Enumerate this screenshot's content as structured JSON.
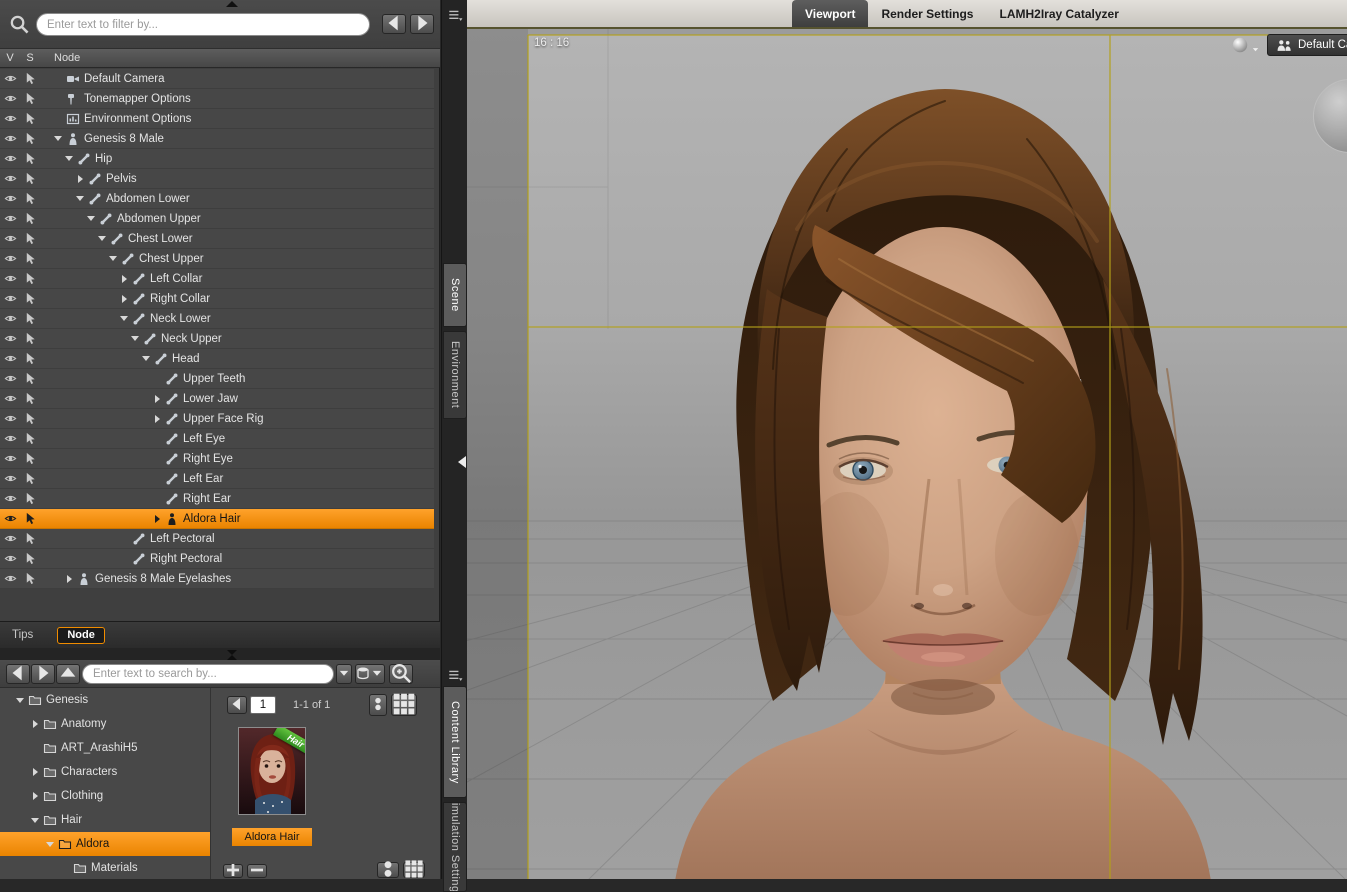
{
  "colors": {
    "accent": "#f08c00",
    "guide_yellow": "#b3a01a",
    "badge_green": "#3fae3f"
  },
  "scene_panel": {
    "filter_placeholder": "Enter text to filter by...",
    "columns": {
      "v": "V",
      "s": "S",
      "node": "Node"
    },
    "nodes": [
      {
        "label": "Default Camera",
        "indent": 0,
        "icon": "camera",
        "expander": "none"
      },
      {
        "label": "Tonemapper Options",
        "indent": 0,
        "icon": "tonemapper",
        "expander": "none"
      },
      {
        "label": "Environment Options",
        "indent": 0,
        "icon": "environment",
        "expander": "none"
      },
      {
        "label": "Genesis 8 Male",
        "indent": 0,
        "icon": "figure",
        "expander": "open"
      },
      {
        "label": "Hip",
        "indent": 1,
        "icon": "bone",
        "expander": "open"
      },
      {
        "label": "Pelvis",
        "indent": 2,
        "icon": "bone",
        "expander": "closed"
      },
      {
        "label": "Abdomen Lower",
        "indent": 2,
        "icon": "bone",
        "expander": "open"
      },
      {
        "label": "Abdomen Upper",
        "indent": 3,
        "icon": "bone",
        "expander": "open"
      },
      {
        "label": "Chest Lower",
        "indent": 4,
        "icon": "bone",
        "expander": "open"
      },
      {
        "label": "Chest Upper",
        "indent": 5,
        "icon": "bone",
        "expander": "open"
      },
      {
        "label": "Left Collar",
        "indent": 6,
        "icon": "bone",
        "expander": "closed"
      },
      {
        "label": "Right Collar",
        "indent": 6,
        "icon": "bone",
        "expander": "closed"
      },
      {
        "label": "Neck Lower",
        "indent": 6,
        "icon": "bone",
        "expander": "open"
      },
      {
        "label": "Neck Upper",
        "indent": 7,
        "icon": "bone",
        "expander": "open"
      },
      {
        "label": "Head",
        "indent": 8,
        "icon": "bone",
        "expander": "open"
      },
      {
        "label": "Upper Teeth",
        "indent": 9,
        "icon": "bone",
        "expander": "none"
      },
      {
        "label": "Lower Jaw",
        "indent": 9,
        "icon": "bone",
        "expander": "closed"
      },
      {
        "label": "Upper Face Rig",
        "indent": 9,
        "icon": "bone",
        "expander": "closed"
      },
      {
        "label": "Left Eye",
        "indent": 9,
        "icon": "bone",
        "expander": "none"
      },
      {
        "label": "Right Eye",
        "indent": 9,
        "icon": "bone",
        "expander": "none"
      },
      {
        "label": "Left Ear",
        "indent": 9,
        "icon": "bone",
        "expander": "none"
      },
      {
        "label": "Right Ear",
        "indent": 9,
        "icon": "bone",
        "expander": "none"
      },
      {
        "label": "Aldora Hair",
        "indent": 9,
        "icon": "figure",
        "expander": "closed",
        "selected": true
      },
      {
        "label": "Left Pectoral",
        "indent": 6,
        "icon": "bone",
        "expander": "none"
      },
      {
        "label": "Right Pectoral",
        "indent": 6,
        "icon": "bone",
        "expander": "none"
      },
      {
        "label": "Genesis 8 Male Eyelashes",
        "indent": 1,
        "icon": "figure",
        "expander": "closed"
      }
    ],
    "footer": {
      "tips_label": "Tips",
      "node_label": "Node"
    }
  },
  "side_tabs": {
    "scene": "Scene",
    "environment": "Environment",
    "content_library": "Content Library",
    "simulation": "Simulation Settings"
  },
  "content_panel": {
    "search_placeholder": "Enter text to search by...",
    "folders": [
      {
        "label": "Genesis",
        "indent": 0,
        "icon": "folder",
        "expander": "open"
      },
      {
        "label": "Anatomy",
        "indent": 1,
        "icon": "folder",
        "expander": "closed"
      },
      {
        "label": "ART_ArashiH5",
        "indent": 1,
        "icon": "folder",
        "expander": "none"
      },
      {
        "label": "Characters",
        "indent": 1,
        "icon": "folder",
        "expander": "closed"
      },
      {
        "label": "Clothing",
        "indent": 1,
        "icon": "folder",
        "expander": "closed"
      },
      {
        "label": "Hair",
        "indent": 1,
        "icon": "folder",
        "expander": "open"
      },
      {
        "label": "Aldora",
        "indent": 2,
        "icon": "folder",
        "expander": "open",
        "selected": true
      },
      {
        "label": "Materials",
        "indent": 3,
        "icon": "folder",
        "expander": "none"
      }
    ],
    "pager": {
      "page": "1",
      "range_label": "1-1 of 1"
    },
    "product": {
      "name": "Aldora Hair",
      "badge": "Hair"
    }
  },
  "viewport": {
    "tabs": [
      {
        "label": "Viewport",
        "active": true
      },
      {
        "label": "Render Settings",
        "active": false
      },
      {
        "label": "LAMH2Iray Catalyzer",
        "active": false
      }
    ],
    "aspect_label": "16 : 16",
    "camera_button_label": "Default Camera"
  }
}
